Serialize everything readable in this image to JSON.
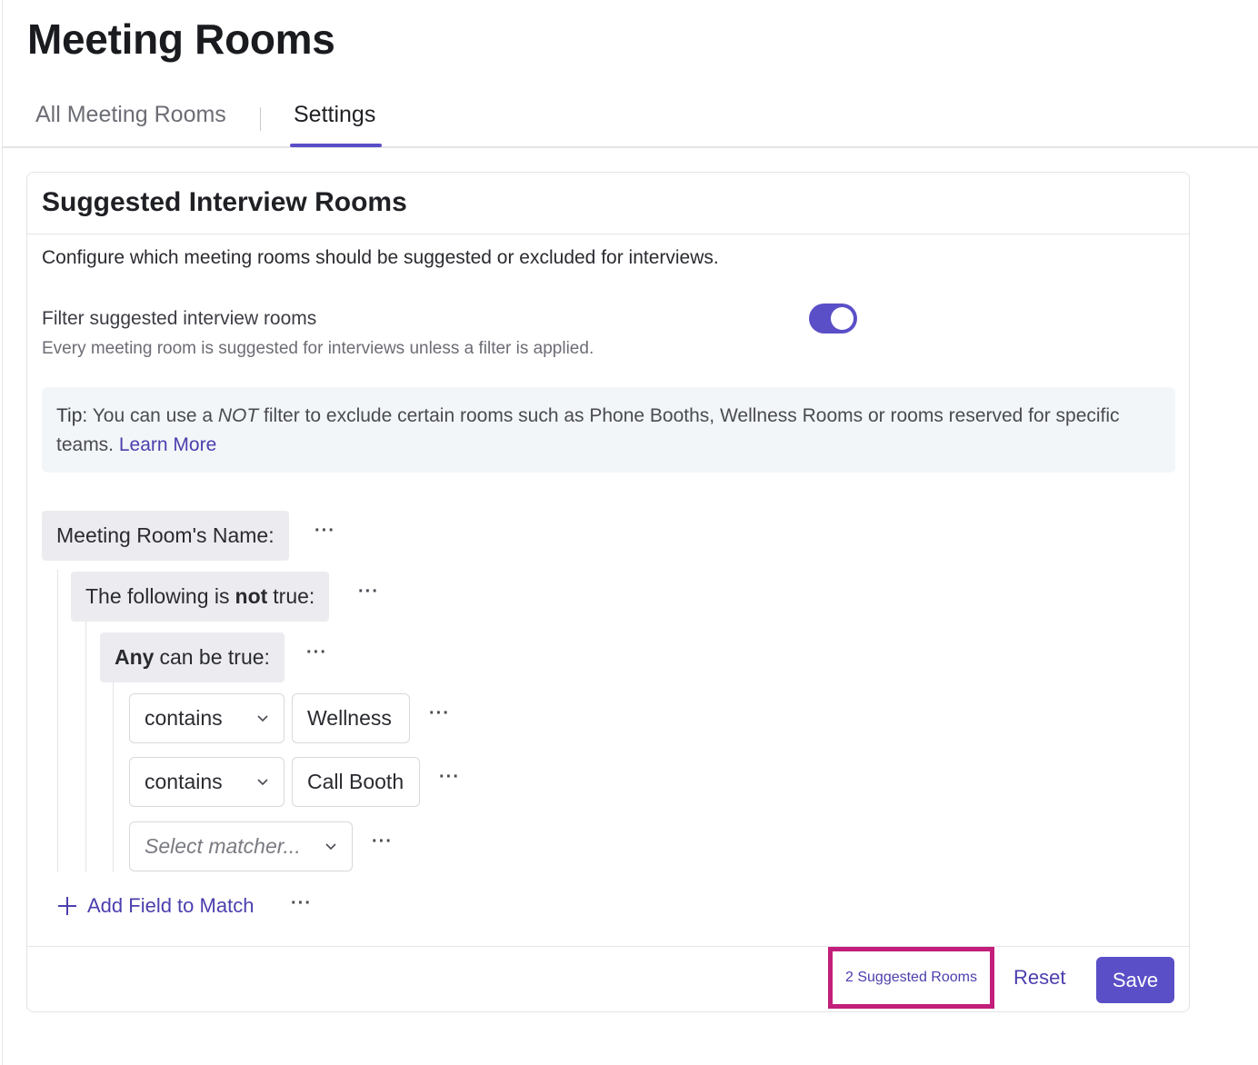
{
  "page": {
    "title": "Meeting Rooms"
  },
  "tabs": [
    {
      "label": "All Meeting Rooms",
      "active": false
    },
    {
      "label": "Settings",
      "active": true
    }
  ],
  "card": {
    "title": "Suggested Interview Rooms",
    "description": "Configure which meeting rooms should be suggested or excluded for interviews.",
    "filter": {
      "label": "Filter suggested interview rooms",
      "sublabel": "Every meeting room is suggested for interviews unless a filter is applied.",
      "enabled": true
    },
    "tip": {
      "prefix": "Tip:",
      "text_before": " You can use a ",
      "emphasis": "NOT",
      "text_after": " filter to exclude certain rooms such as Phone Booths, Wellness Rooms or rooms reserved for specific teams. ",
      "link": "Learn More"
    },
    "rules": {
      "field_label": "Meeting Room's Name:",
      "not_group": {
        "before": "The following is ",
        "bold": "not",
        "after": " true:"
      },
      "any_group": {
        "bold": "Any",
        "after": " can be true:"
      },
      "conditions": [
        {
          "matcher": "contains",
          "value": "Wellness"
        },
        {
          "matcher": "contains",
          "value": "Call Booth"
        }
      ],
      "new_matcher_placeholder": "Select matcher...",
      "more": "···"
    },
    "add_field_label": "Add Field to Match",
    "footer": {
      "suggested_rooms": "2 Suggested Rooms",
      "reset": "Reset",
      "save": "Save"
    }
  },
  "colors": {
    "accent": "#5b4fc7",
    "link": "#4b3fae",
    "highlight": "#c21e7a"
  }
}
